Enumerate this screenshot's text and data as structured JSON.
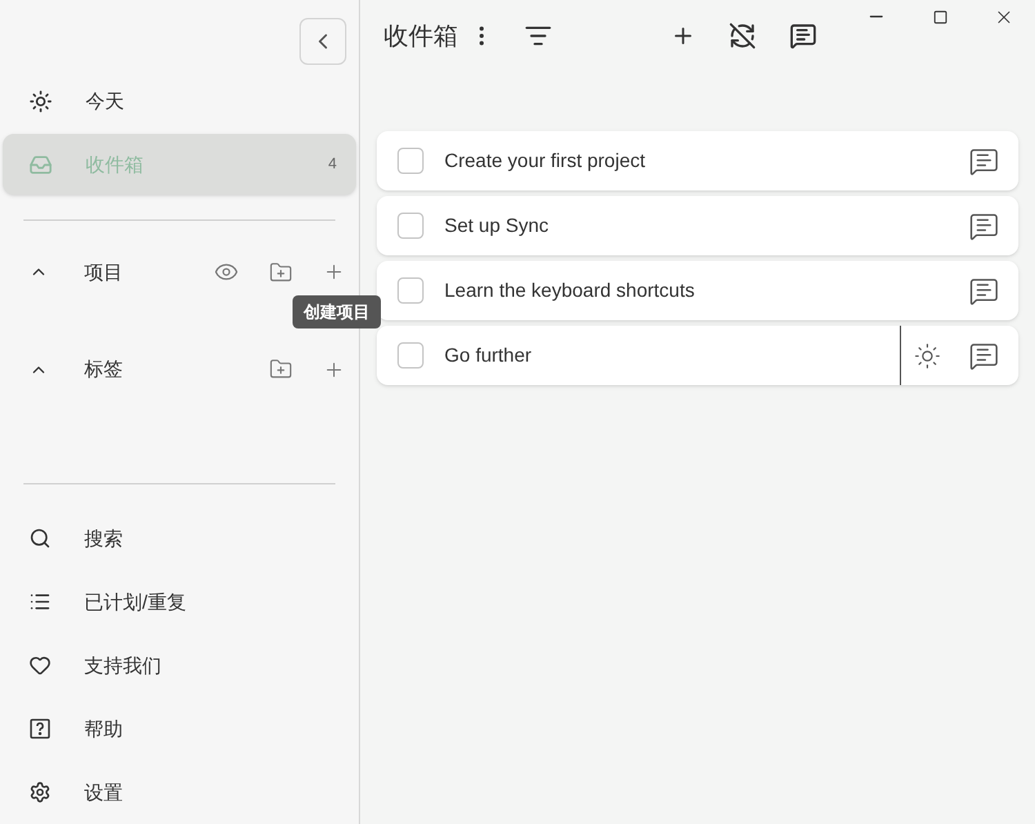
{
  "sidebar": {
    "top_items": [
      {
        "label": "今天",
        "selected": false
      },
      {
        "label": "收件箱",
        "count": "4",
        "selected": true
      }
    ],
    "groups": [
      {
        "label": "项目",
        "expanded": true,
        "tooltip": "创建项目"
      },
      {
        "label": "标签",
        "expanded": true
      }
    ],
    "bottom_items": [
      {
        "label": "搜索"
      },
      {
        "label": "已计划/重复"
      },
      {
        "label": "支持我们"
      },
      {
        "label": "帮助"
      },
      {
        "label": "设置"
      }
    ]
  },
  "header": {
    "title": "收件箱"
  },
  "tasks": [
    {
      "title": "Create your first project",
      "checked": false,
      "today_button": false
    },
    {
      "title": "Set up Sync",
      "checked": false,
      "today_button": false
    },
    {
      "title": "Learn the keyboard shortcuts",
      "checked": false,
      "today_button": false
    },
    {
      "title": "Go further",
      "checked": false,
      "today_button": true
    }
  ]
}
